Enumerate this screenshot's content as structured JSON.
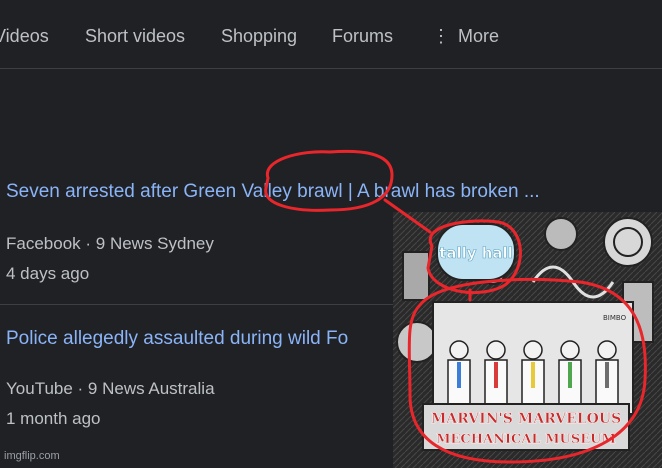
{
  "tabs": {
    "videos": "Videos",
    "short_videos": "Short videos",
    "shopping": "Shopping",
    "forums": "Forums",
    "more": "More"
  },
  "results": [
    {
      "title": "Seven arrested after Green Valley brawl | A brawl has broken ...",
      "source": "Facebook · 9 News Sydney",
      "age": "4 days ago"
    },
    {
      "title": "Police allegedly assaulted during wild Fo",
      "source": "YouTube · 9 News Australia",
      "age": "1 month ago"
    }
  ],
  "thumbnail": {
    "logo_text": "tally hall",
    "banner_line1": "MARVIN'S MARVELOUS",
    "banner_line2": "MECHANICAL MUSEUM",
    "sign_text": "BIMBO",
    "band_colors": [
      "#3b7dd8",
      "#d93a3a",
      "#e8c93a",
      "#4fa64f",
      "#6e6e6e"
    ]
  },
  "annotation_color": "#e8262b",
  "watermark": "imgflip.com"
}
